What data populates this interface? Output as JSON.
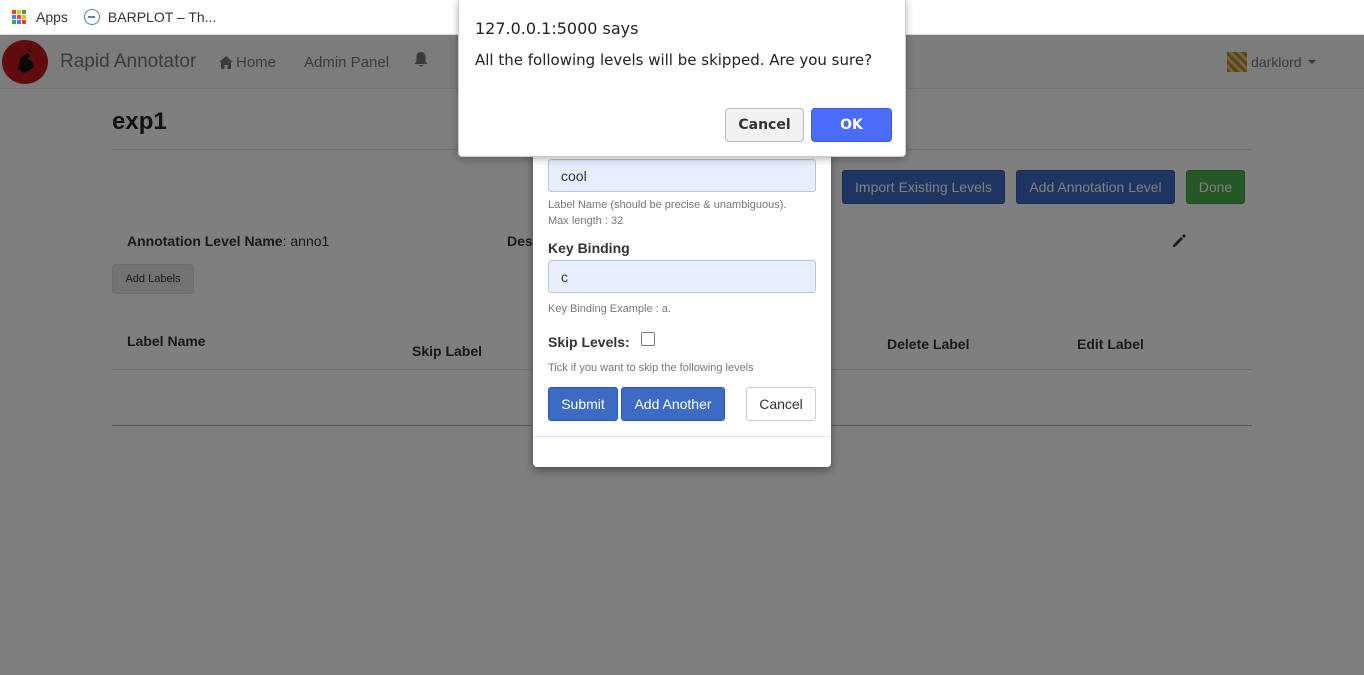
{
  "bookmarks": {
    "apps_label": "Apps",
    "tab_label": "BARPLOT – Th..."
  },
  "navbar": {
    "brand": "Rapid Annotator",
    "home": "Home",
    "admin_panel": "Admin Panel",
    "username": "darklord"
  },
  "page": {
    "title": "exp1",
    "buttons": {
      "import": "Import Existing Levels",
      "add_level": "Add Annotation Level",
      "done": "Done"
    },
    "level_name_label": "Annotation Level Name",
    "level_name_value": ": anno1",
    "description_label": "Des",
    "add_labels": "Add Labels",
    "table_headers": {
      "label_name": "Label Name",
      "skip_label": "Skip Label",
      "delete_label": "Delete Label",
      "edit_label": "Edit Label"
    }
  },
  "modal": {
    "label_name_value": "cool",
    "label_help_1": "Label Name (should be precise & unambiguous).",
    "label_help_2": "Max length : 32",
    "key_binding_label": "Key Binding",
    "key_binding_value": "c",
    "key_binding_help": "Key Binding Example : a.",
    "skip_levels_label": "Skip Levels:",
    "skip_levels_help": "Tick if you want to skip the following levels",
    "submit": "Submit",
    "add_another": "Add Another",
    "cancel": "Cancel"
  },
  "alert": {
    "title": "127.0.0.1:5000 says",
    "message": "All the following levels will be skipped. Are you sure?",
    "cancel": "Cancel",
    "ok": "OK"
  },
  "colors": {
    "primary": "#3c6bc4",
    "success": "#4cae4c",
    "alert_ok": "#4a6cf7"
  }
}
